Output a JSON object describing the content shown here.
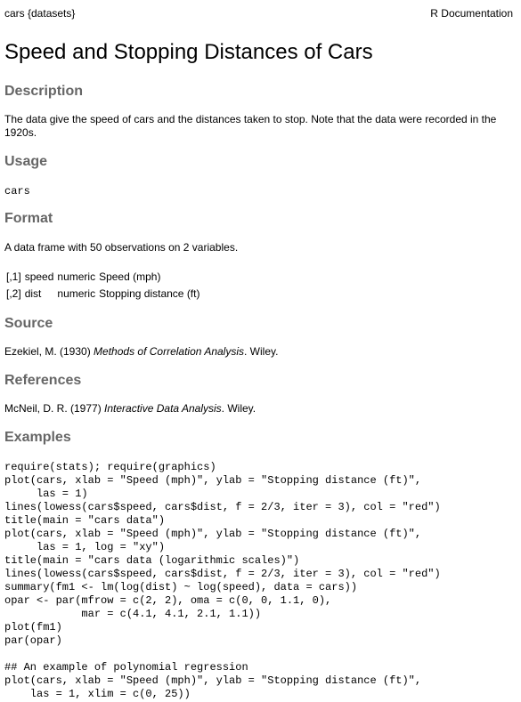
{
  "header": {
    "package": "cars {datasets}",
    "doc_type": "R Documentation"
  },
  "title": "Speed and Stopping Distances of Cars",
  "description": {
    "heading": "Description",
    "text": "The data give the speed of cars and the distances taken to stop. Note that the data were recorded in the 1920s."
  },
  "usage": {
    "heading": "Usage",
    "code": "cars"
  },
  "format": {
    "heading": "Format",
    "text": "A data frame with 50 observations on 2 variables.",
    "rows": [
      {
        "index": "[,1]",
        "name": "speed",
        "type": "numeric",
        "desc": "Speed (mph)"
      },
      {
        "index": "[,2]",
        "name": "dist",
        "type": "numeric",
        "desc": "Stopping distance (ft)"
      }
    ]
  },
  "source": {
    "heading": "Source",
    "prefix": "Ezekiel, M. (1930) ",
    "title": "Methods of Correlation Analysis",
    "suffix": ". Wiley."
  },
  "references": {
    "heading": "References",
    "prefix": "McNeil, D. R. (1977) ",
    "title": "Interactive Data Analysis",
    "suffix": ". Wiley."
  },
  "examples": {
    "heading": "Examples",
    "code": "require(stats); require(graphics)\nplot(cars, xlab = \"Speed (mph)\", ylab = \"Stopping distance (ft)\",\n     las = 1)\nlines(lowess(cars$speed, cars$dist, f = 2/3, iter = 3), col = \"red\")\ntitle(main = \"cars data\")\nplot(cars, xlab = \"Speed (mph)\", ylab = \"Stopping distance (ft)\",\n     las = 1, log = \"xy\")\ntitle(main = \"cars data (logarithmic scales)\")\nlines(lowess(cars$speed, cars$dist, f = 2/3, iter = 3), col = \"red\")\nsummary(fm1 <- lm(log(dist) ~ log(speed), data = cars))\nopar <- par(mfrow = c(2, 2), oma = c(0, 0, 1.1, 0),\n            mar = c(4.1, 4.1, 2.1, 1.1))\nplot(fm1)\npar(opar)\n\n## An example of polynomial regression\nplot(cars, xlab = \"Speed (mph)\", ylab = \"Stopping distance (ft)\",\n    las = 1, xlim = c(0, 25))"
  }
}
